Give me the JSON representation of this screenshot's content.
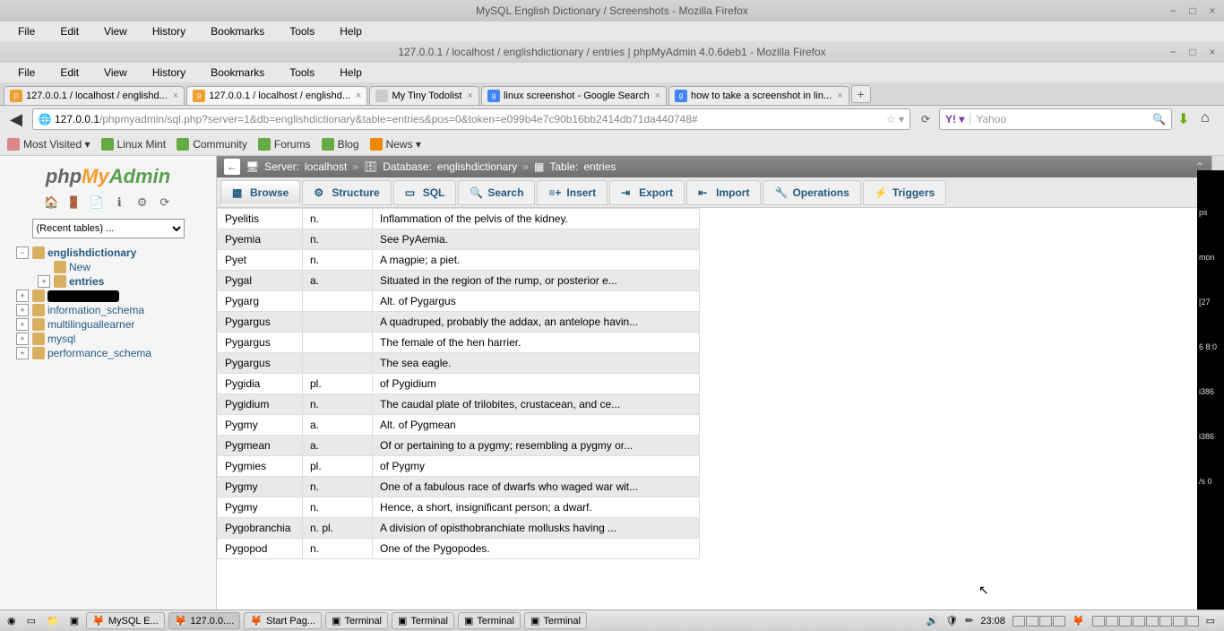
{
  "window1": {
    "title": "MySQL English Dictionary / Screenshots - Mozilla Firefox",
    "menu": [
      "File",
      "Edit",
      "View",
      "History",
      "Bookmarks",
      "Tools",
      "Help"
    ]
  },
  "window2": {
    "title": "127.0.0.1 / localhost / englishdictionary / entries | phpMyAdmin 4.0.6deb1 - Mozilla Firefox",
    "menu": [
      "File",
      "Edit",
      "View",
      "History",
      "Bookmarks",
      "Tools",
      "Help"
    ]
  },
  "tabs": [
    {
      "label": "127.0.0.1 / localhost / englishd...",
      "icon": "pma"
    },
    {
      "label": "127.0.0.1 / localhost / englishd...",
      "icon": "pma",
      "active": true
    },
    {
      "label": "My Tiny Todolist",
      "icon": "doc"
    },
    {
      "label": "linux screenshot - Google Search",
      "icon": "g"
    },
    {
      "label": "how to take a screenshot in lin...",
      "icon": "g"
    }
  ],
  "url": {
    "host": "127.0.0.1",
    "path": "/phpmyadmin/sql.php?server=1&db=englishdictionary&table=entries&pos=0&token=e099b4e7c90b16bb2414db71da440748#"
  },
  "search": {
    "engine": "Y!",
    "dropdown": "▾",
    "placeholder": "Yahoo"
  },
  "bookmarks": [
    {
      "label": "Most Visited ▾",
      "color": "#d88"
    },
    {
      "label": "Linux Mint",
      "color": "#6a4"
    },
    {
      "label": "Community",
      "color": "#6a4"
    },
    {
      "label": "Forums",
      "color": "#6a4"
    },
    {
      "label": "Blog",
      "color": "#6a4"
    },
    {
      "label": "News ▾",
      "color": "#e80"
    }
  ],
  "pma": {
    "logo": {
      "a": "php",
      "b": "My",
      "c": "Admin"
    },
    "recent_label": "(Recent tables) ...",
    "breadcrumb": {
      "server_label": "Server:",
      "server": "localhost",
      "db_label": "Database:",
      "db": "englishdictionary",
      "table_label": "Table:",
      "table": "entries"
    },
    "tabs": [
      {
        "label": "Browse",
        "icon": "▦",
        "active": true
      },
      {
        "label": "Structure",
        "icon": "⚙"
      },
      {
        "label": "SQL",
        "icon": "▭"
      },
      {
        "label": "Search",
        "icon": "🔍"
      },
      {
        "label": "Insert",
        "icon": "≡+"
      },
      {
        "label": "Export",
        "icon": "⇥"
      },
      {
        "label": "Import",
        "icon": "⇤"
      },
      {
        "label": "Operations",
        "icon": "🔧"
      },
      {
        "label": "Triggers",
        "icon": "⚡"
      }
    ],
    "tree": [
      {
        "name": "englishdictionary",
        "expanded": true,
        "bold": true,
        "level": 0,
        "tog": "−"
      },
      {
        "name": "New",
        "level": 1,
        "tog": ""
      },
      {
        "name": "entries",
        "level": 1,
        "tog": "+",
        "bold": true
      },
      {
        "name": "",
        "level": 0,
        "tog": "+",
        "redact": true
      },
      {
        "name": "information_schema",
        "level": 0,
        "tog": "+"
      },
      {
        "name": "multilinguallearner",
        "level": 0,
        "tog": "+"
      },
      {
        "name": "mysql",
        "level": 0,
        "tog": "+"
      },
      {
        "name": "performance_schema",
        "level": 0,
        "tog": "+"
      }
    ],
    "rows": [
      {
        "w": "Pyelitis",
        "t": "n.",
        "d": "Inflammation of the pelvis of the kidney."
      },
      {
        "w": "Pyemia",
        "t": "n.",
        "d": "See PyAemia."
      },
      {
        "w": "Pyet",
        "t": "n.",
        "d": "A magpie; a piet."
      },
      {
        "w": "Pygal",
        "t": "a.",
        "d": "Situated in the region of the rump, or posterior e..."
      },
      {
        "w": "Pygarg",
        "t": "",
        "d": "Alt. of Pygargus"
      },
      {
        "w": "Pygargus",
        "t": "",
        "d": "A quadruped, probably the addax, an antelope havin..."
      },
      {
        "w": "Pygargus",
        "t": "",
        "d": "The female of the hen harrier."
      },
      {
        "w": "Pygargus",
        "t": "",
        "d": "The sea eagle."
      },
      {
        "w": "Pygidia",
        "t": "pl.",
        "d": "of Pygidium"
      },
      {
        "w": "Pygidium",
        "t": "n.",
        "d": "The caudal plate of trilobites, crustacean, and ce..."
      },
      {
        "w": "Pygmy",
        "t": "a.",
        "d": "Alt. of Pygmean"
      },
      {
        "w": "Pygmean",
        "t": "a.",
        "d": "Of or pertaining to a pygmy; resembling a pygmy or..."
      },
      {
        "w": "Pygmies",
        "t": "pl.",
        "d": "of Pygmy"
      },
      {
        "w": "Pygmy",
        "t": "n.",
        "d": "One of a fabulous race of dwarfs who waged war wit..."
      },
      {
        "w": "Pygmy",
        "t": "n.",
        "d": "Hence, a short, insignificant person; a dwarf."
      },
      {
        "w": "Pygobranchia",
        "t": "n. pl.",
        "d": "A division of opisthobranchiate mollusks having ..."
      },
      {
        "w": "Pygopod",
        "t": "n.",
        "d": "One of the Pygopodes."
      }
    ]
  },
  "taskbar": {
    "items": [
      {
        "label": "MySQL E...",
        "icon": "🦊"
      },
      {
        "label": "127.0.0....",
        "icon": "🦊",
        "active": true
      },
      {
        "label": "Start Pag...",
        "icon": "🦊"
      },
      {
        "label": "Terminal",
        "icon": "▣"
      },
      {
        "label": "Terminal",
        "icon": "▣"
      },
      {
        "label": "Terminal",
        "icon": "▣"
      },
      {
        "label": "Terminal",
        "icon": "▣"
      }
    ],
    "clock": "23:08"
  },
  "terminal_overflow": [
    "ps",
    "mon",
    "[27",
    "6 8:0",
    "i386",
    "i386",
    "/s 0"
  ]
}
